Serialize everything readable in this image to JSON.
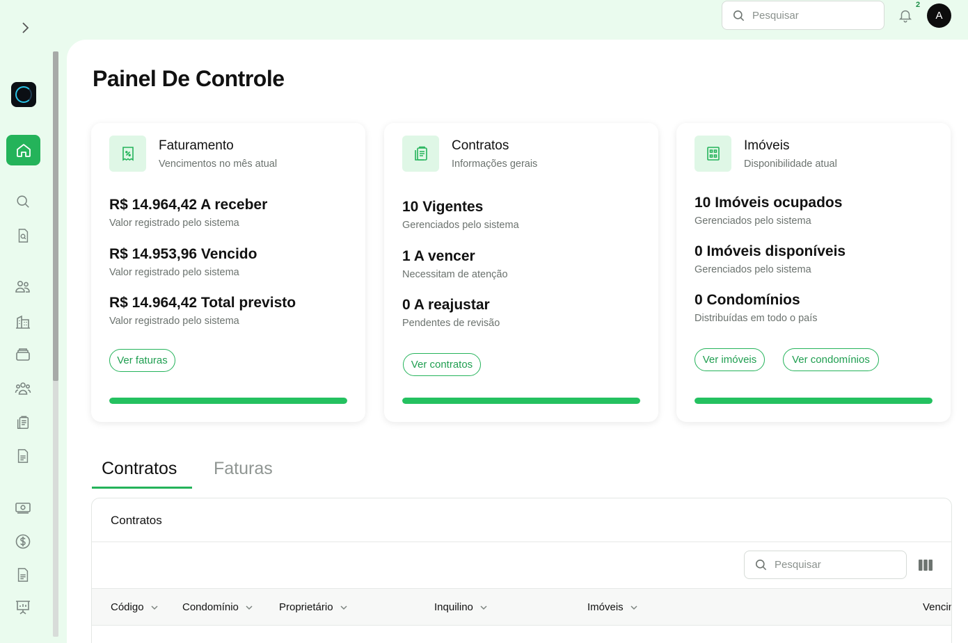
{
  "header": {
    "search_placeholder": "Pesquisar",
    "notification_count": "2",
    "avatar_initial": "A"
  },
  "page": {
    "title": "Painel De Controle"
  },
  "cards": [
    {
      "icon": "receipt-percent-icon",
      "title": "Faturamento",
      "subtitle": "Vencimentos no mês atual",
      "stats": [
        {
          "value": "R$ 14.964,42 A receber",
          "desc": "Valor registrado pelo sistema"
        },
        {
          "value": "R$ 14.953,96 Vencido",
          "desc": "Valor registrado pelo sistema"
        },
        {
          "value": "R$ 14.964,42 Total previsto",
          "desc": "Valor registrado pelo sistema"
        }
      ],
      "buttons": [
        "Ver faturas"
      ],
      "progress": 1.0
    },
    {
      "icon": "clipboard-list-icon",
      "title": "Contratos",
      "subtitle": "Informações gerais",
      "stats": [
        {
          "value": "10 Vigentes",
          "desc": "Gerenciados pelo sistema"
        },
        {
          "value": "1 A vencer",
          "desc": "Necessitam de atenção"
        },
        {
          "value": "0 A reajustar",
          "desc": "Pendentes de revisão"
        }
      ],
      "buttons": [
        "Ver contratos"
      ],
      "progress": 1.0
    },
    {
      "icon": "building-icon",
      "title": "Imóveis",
      "subtitle": "Disponibilidade atual",
      "stats": [
        {
          "value": "10 Imóveis ocupados",
          "desc": "Gerenciados pelo sistema"
        },
        {
          "value": "0 Imóveis disponíveis",
          "desc": "Gerenciados pelo sistema"
        },
        {
          "value": "0 Condomínios",
          "desc": "Distribuídas em todo o país"
        }
      ],
      "buttons": [
        "Ver imóveis",
        "Ver condomínios"
      ],
      "progress": 1.0
    }
  ],
  "tabs": [
    {
      "label": "Contratos",
      "active": true
    },
    {
      "label": "Faturas",
      "active": false
    }
  ],
  "table": {
    "title": "Contratos",
    "search_placeholder": "Pesquisar",
    "columns": [
      "Código",
      "Condomínio",
      "Proprietário",
      "Inquilino",
      "Imóveis",
      "Vencimento"
    ]
  },
  "colors": {
    "accent": "#24b35a",
    "background": "#eafbee",
    "icon_bg": "#dff7e6"
  }
}
